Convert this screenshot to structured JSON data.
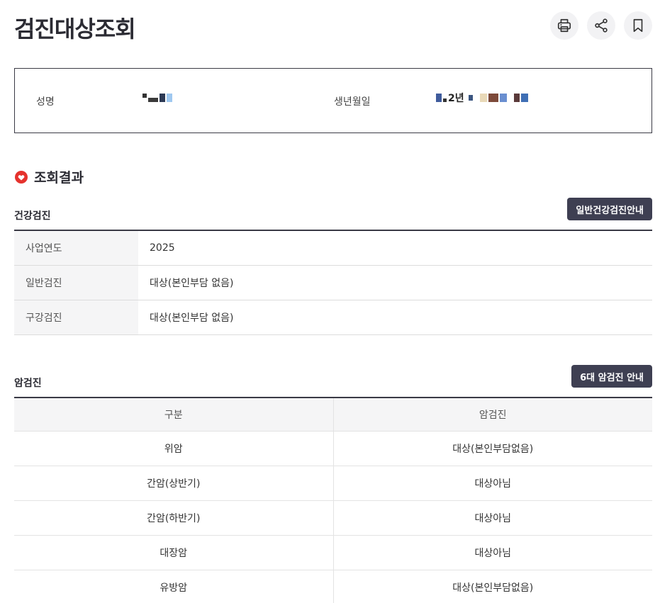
{
  "page": {
    "title": "검진대상조회"
  },
  "actions": {
    "print": "print-icon",
    "share": "share-icon",
    "bookmark": "bookmark-icon"
  },
  "person": {
    "name_label": "성명",
    "birth_label": "생년월일",
    "birth_partial": "2년"
  },
  "result": {
    "title": "조회결과"
  },
  "health": {
    "title": "건강검진",
    "guide_button": "일반건강검진안내",
    "rows": [
      {
        "label": "사업연도",
        "value": "2025"
      },
      {
        "label": "일반검진",
        "value": "대상(본인부담 없음)"
      },
      {
        "label": "구강검진",
        "value": "대상(본인부담 없음)"
      }
    ]
  },
  "cancer": {
    "title": "암검진",
    "guide_button": "6대 암검진 안내",
    "headers": [
      "구분",
      "암검진"
    ],
    "rows": [
      {
        "type": "위암",
        "status": "대상(본인부담없음)"
      },
      {
        "type": "간암(상반기)",
        "status": "대상아님"
      },
      {
        "type": "간암(하반기)",
        "status": "대상아님"
      },
      {
        "type": "대장암",
        "status": "대상아님"
      },
      {
        "type": "유방암",
        "status": "대상(본인부담없음)"
      }
    ]
  },
  "colors": {
    "accent": "#3e3f52",
    "heart": "#e5322d",
    "border": "#3a3a45"
  }
}
